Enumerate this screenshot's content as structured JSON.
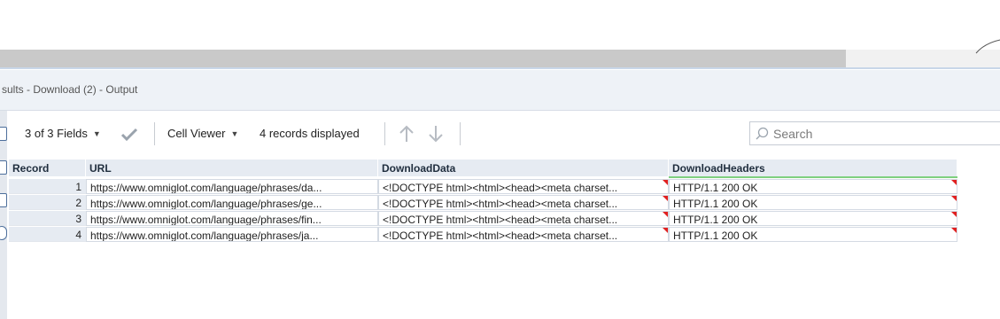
{
  "window": {
    "title": "sults - Download (2) - Output"
  },
  "toolbar": {
    "fields_label": "3 of 3 Fields",
    "cell_viewer_label": "Cell Viewer",
    "records_label": "4 records displayed"
  },
  "search": {
    "placeholder": "Search"
  },
  "table": {
    "columns": [
      "Record",
      "URL",
      "DownloadData",
      "DownloadHeaders"
    ],
    "rows": [
      {
        "record": "1",
        "url": "https://www.omniglot.com/language/phrases/da...",
        "data": "<!DOCTYPE html><html><head><meta charset...",
        "headers": "HTTP/1.1 200 OK"
      },
      {
        "record": "2",
        "url": "https://www.omniglot.com/language/phrases/ge...",
        "data": "<!DOCTYPE html><html><head><meta charset...",
        "headers": "HTTP/1.1 200 OK"
      },
      {
        "record": "3",
        "url": "https://www.omniglot.com/language/phrases/fin...",
        "data": "<!DOCTYPE html><html><head><meta charset...",
        "headers": "HTTP/1.1 200 OK"
      },
      {
        "record": "4",
        "url": "https://www.omniglot.com/language/phrases/ja...",
        "data": "<!DOCTYPE html><html><head><meta charset...",
        "headers": "HTTP/1.1 200 OK"
      }
    ]
  },
  "colors": {
    "accent": "#4d6f9c",
    "header_bg": "#e6ebf2",
    "header_underline": "#7fd07f",
    "truncation_flag": "#e02020"
  },
  "icons": [
    "checkmark-icon",
    "caret-down-icon",
    "arrow-up-icon",
    "arrow-down-icon",
    "search-icon"
  ]
}
